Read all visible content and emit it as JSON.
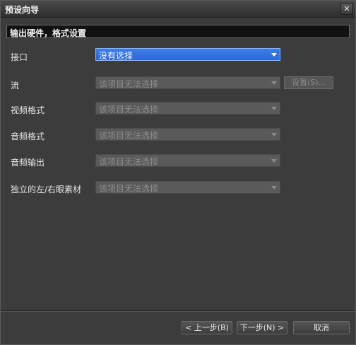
{
  "window": {
    "title": "预设向导",
    "close_glyph": "✕"
  },
  "section": {
    "header": "输出硬件，格式设置"
  },
  "fields": [
    {
      "label": "接口",
      "value": "没有选择",
      "enabled": true
    },
    {
      "label": "流",
      "value": "该项目无法选择",
      "enabled": false
    },
    {
      "label": "视频格式",
      "value": "该项目无法选择",
      "enabled": false
    },
    {
      "label": "音频格式",
      "value": "该项目无法选择",
      "enabled": false
    },
    {
      "label": "音频输出",
      "value": "该项目无法选择",
      "enabled": false
    },
    {
      "label": "独立的左/右眼素材",
      "value": "该项目无法选择",
      "enabled": false
    }
  ],
  "settings_button": {
    "label": "设置(S)..."
  },
  "footer": {
    "prev_label": "< 上一步(B)",
    "next_label": "下一步(N) >",
    "cancel_label": "取消"
  },
  "colors": {
    "accent": "#2a67d8",
    "background": "#3c3c3c"
  }
}
